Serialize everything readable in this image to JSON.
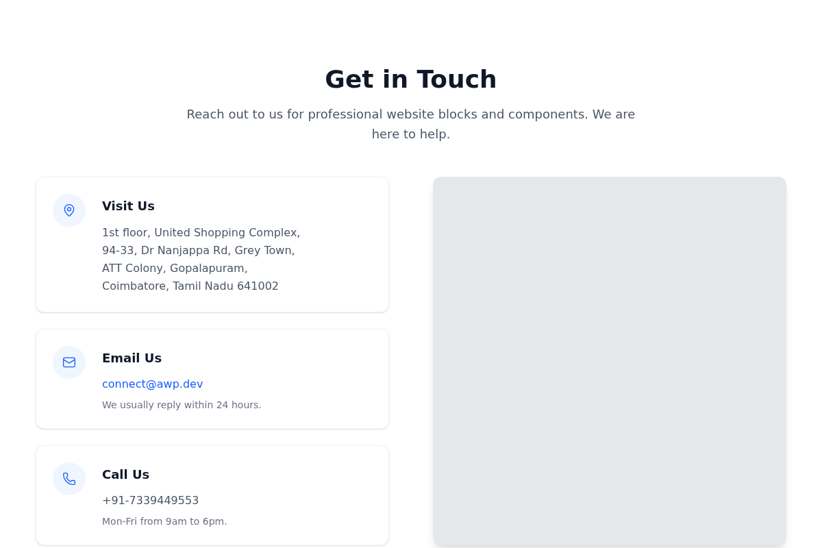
{
  "header": {
    "title": "Get in Touch",
    "subtitle": "Reach out to us for professional website blocks and components. We are here to help."
  },
  "cards": [
    {
      "kind": "address",
      "title": "Visit Us",
      "lines": [
        "1st floor, United Shopping Complex,",
        "94-33, Dr Nanjappa Rd, Grey Town,",
        "ATT Colony, Gopalapuram,",
        "Coimbatore, Tamil Nadu 641002"
      ]
    },
    {
      "kind": "email",
      "title": "Email Us",
      "value": "connect@awp.dev",
      "note": "We usually reply within 24 hours."
    },
    {
      "kind": "phone",
      "title": "Call Us",
      "value": "+91-7339449553",
      "note": "Mon-Fri from 9am to 6pm."
    }
  ]
}
